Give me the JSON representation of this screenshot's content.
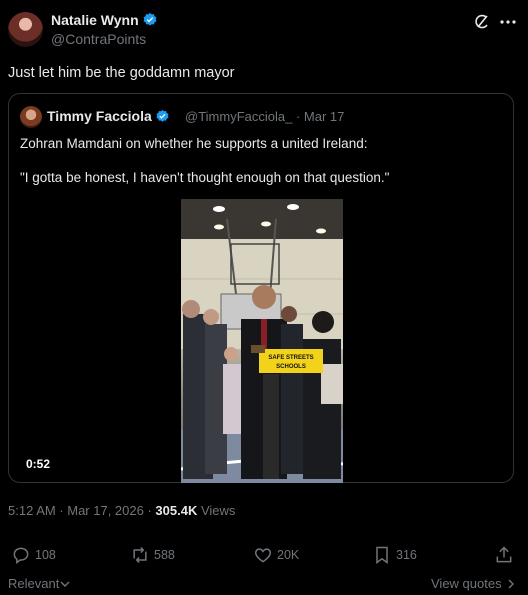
{
  "author": {
    "name": "Natalie Wynn",
    "handle": "@ContraPoints"
  },
  "post": {
    "text": "Just let him be the goddamn mayor",
    "timestamp": "5:12 AM · Mar 17, 2026 · ",
    "views_count": "305.4K",
    "views_label": " Views"
  },
  "quote": {
    "name": "Timmy Facciola",
    "handle_date": "@TimmyFacciola_ · Mar 17",
    "line1": "Zohran Mamdani on whether he supports a united Ireland:",
    "line2": "\"I gotta be honest, I haven't thought enough on that question.\"",
    "video_duration": "0:52",
    "sign_text_1": "SAFE STREETS",
    "sign_text_2": "SCHOOLS"
  },
  "actions": {
    "replies": "108",
    "reposts": "588",
    "likes": "20K",
    "bookmarks": "316"
  },
  "footer": {
    "sort_label": "Relevant",
    "view_quotes": "View quotes"
  },
  "colors": {
    "verified": "#1d9bf0",
    "muted": "#71767b",
    "border": "#2f3336"
  },
  "icons": [
    "verified-badge-icon",
    "grok-icon",
    "more-icon",
    "reply-icon",
    "repost-icon",
    "like-icon",
    "bookmark-icon",
    "share-icon",
    "chevron-down-icon",
    "chevron-right-icon"
  ]
}
